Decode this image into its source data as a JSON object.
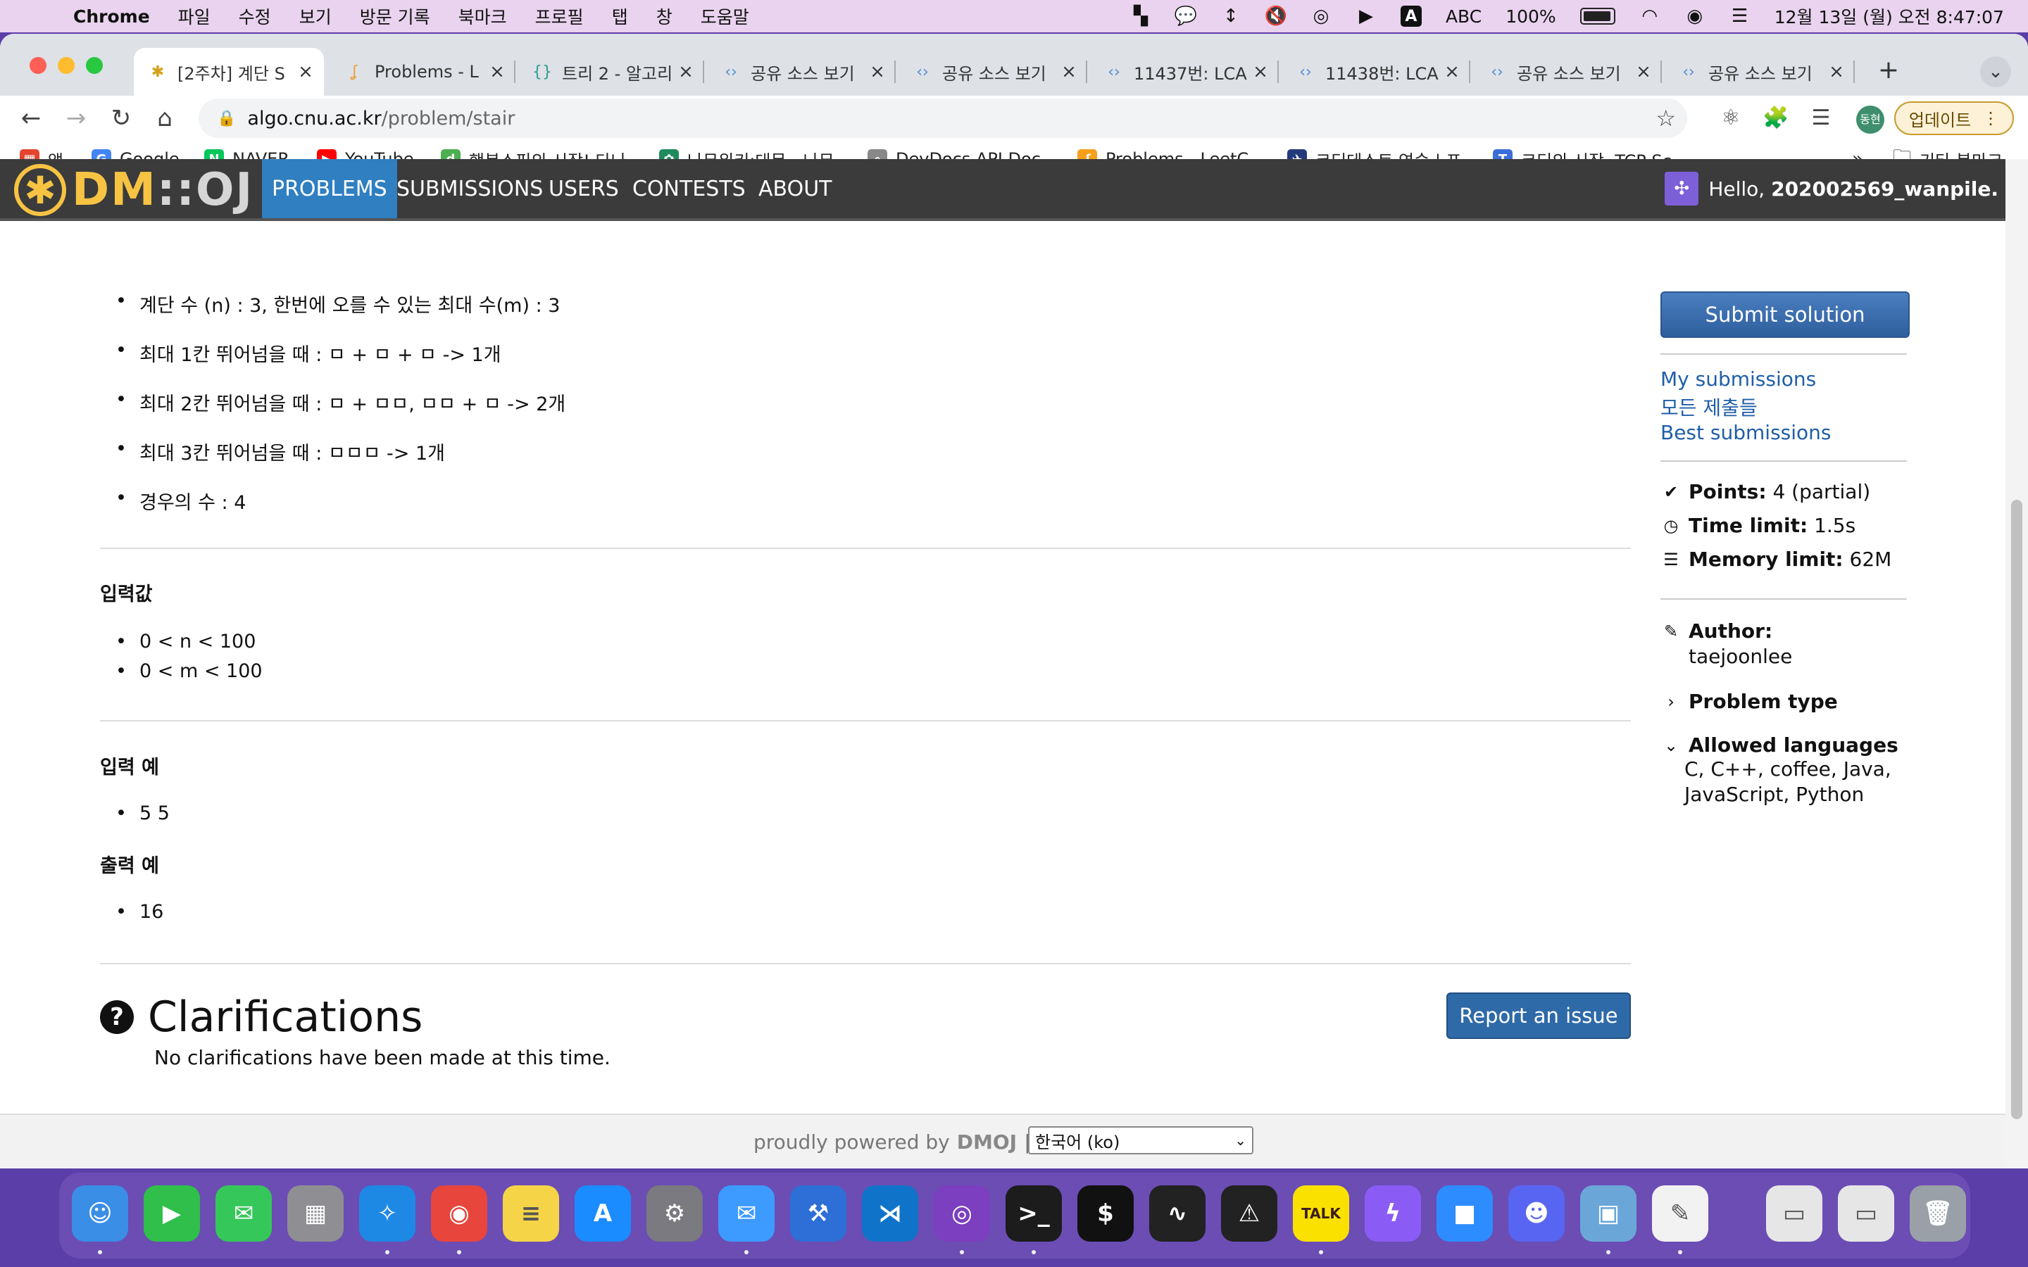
{
  "menubar": {
    "app_name": "Chrome",
    "items": [
      "파일",
      "수정",
      "보기",
      "방문 기록",
      "북마크",
      "프로필",
      "탭",
      "창",
      "도움말"
    ],
    "input_source": "ABC",
    "battery": "100%",
    "clock": "12월 13일 (월) 오전 8:47:07"
  },
  "tabs": [
    {
      "label": "[2주차] 계단 S",
      "icon": "dmoj-star-icon",
      "active": true
    },
    {
      "label": "Problems - L",
      "icon": "leetcode-icon"
    },
    {
      "label": "트리 2 - 알고리",
      "icon": "code-brace-icon"
    },
    {
      "label": "공유 소스 보기",
      "icon": "code-icon"
    },
    {
      "label": "공유 소스 보기",
      "icon": "code-icon"
    },
    {
      "label": "11437번: LCA",
      "icon": "code-icon"
    },
    {
      "label": "11438번: LCA",
      "icon": "code-icon"
    },
    {
      "label": "공유 소스 보기",
      "icon": "code-icon"
    },
    {
      "label": "공유 소스 보기",
      "icon": "code-icon"
    }
  ],
  "address": {
    "host": "algo.cnu.ac.kr",
    "path": "/problem/stair"
  },
  "update_button": "업데이트",
  "profile_initials": "동현",
  "bookmarks": [
    {
      "label": "앱",
      "color": "#e3452f"
    },
    {
      "label": "Google",
      "color": "#4285f4"
    },
    {
      "label": "NAVER",
      "color": "#03c75a"
    },
    {
      "label": "YouTube",
      "color": "#ff0000"
    },
    {
      "label": "행복쇼핑의 시작! 다나...",
      "color": "#4caf50"
    },
    {
      "label": "나무위키:대문 - 나무...",
      "color": "#1f8a5c"
    },
    {
      "label": "DevDocs API Doc...",
      "color": "#888888"
    },
    {
      "label": "Problems - LeetC...",
      "color": "#f89f1b"
    },
    {
      "label": "코딩테스트 연습 | 프...",
      "color": "#233a7d"
    },
    {
      "label": "코딩의 시작, TCP Sc...",
      "color": "#3c6ed9"
    }
  ],
  "bookmarks_more": "»",
  "other_bookmarks": "기타 북마크",
  "site": {
    "logo_dm": "DM",
    "logo_sep": "::",
    "logo_oj": "OJ",
    "nav": [
      "PROBLEMS",
      "SUBMISSIONS",
      "USERS",
      "CONTESTS",
      "ABOUT"
    ],
    "hello_prefix": "Hello, ",
    "username": "202002569_wanpile."
  },
  "problem": {
    "example_bullets": [
      "계단 수 (n) : 3, 한번에 오를 수 있는 최대 수(m) : 3",
      "최대 1칸 뛰어넘을 때 : ㅁ + ㅁ + ㅁ -> 1개",
      "최대 2칸 뛰어넘을 때 : ㅁ + ㅁㅁ, ㅁㅁ + ㅁ -> 2개",
      "최대 3칸 뛰어넘을 때 : ㅁㅁㅁ -> 1개",
      "경우의 수 : 4"
    ],
    "input_heading": "입력값",
    "input_bullets": [
      "0 < n < 100",
      "0 < m < 100"
    ],
    "sample_input_heading": "입력 예",
    "sample_input": "5 5",
    "sample_output_heading": "출력 예",
    "sample_output": "16"
  },
  "clarifications": {
    "title": "Clarifications",
    "text": "No clarifications have been made at this time.",
    "report_button": "Report an issue"
  },
  "sidebar": {
    "submit_button": "Submit solution",
    "links": [
      "My submissions",
      "모든 제출들",
      "Best submissions"
    ],
    "points_label": "Points:",
    "points_value": "4 (partial)",
    "time_label": "Time limit:",
    "time_value": "1.5s",
    "memory_label": "Memory limit:",
    "memory_value": "62M",
    "author_label": "Author:",
    "author_value": "taejoonlee",
    "problem_type_label": "Problem type",
    "languages_label": "Allowed languages",
    "languages_line1": "C, C++, coffee, Java,",
    "languages_line2": "JavaScript, Python"
  },
  "footer": {
    "powered_prefix": "proudly powered by",
    "powered_brand": "DMOJ",
    "separator": "|",
    "language": "한국어 (ko)"
  },
  "dock": [
    {
      "name": "finder-icon",
      "color": "#3a8ee6",
      "glyph": "☺"
    },
    {
      "name": "facetime-icon",
      "color": "#2fbf4a",
      "glyph": "▶"
    },
    {
      "name": "messages-icon",
      "color": "#35c759",
      "glyph": "✉"
    },
    {
      "name": "launchpad-icon",
      "color": "#8e8e93",
      "glyph": "▦"
    },
    {
      "name": "safari-icon",
      "color": "#1e88e5",
      "glyph": "✧"
    },
    {
      "name": "chrome-icon",
      "color": "#e8453c",
      "glyph": "◉"
    },
    {
      "name": "notes-icon",
      "color": "#f5d547",
      "glyph": "≡"
    },
    {
      "name": "app-store-icon",
      "color": "#1a8cff",
      "glyph": "A"
    },
    {
      "name": "system-preferences-icon",
      "color": "#7a7a80",
      "glyph": "⚙"
    },
    {
      "name": "mail-icon",
      "color": "#3d9bff",
      "glyph": "✉"
    },
    {
      "name": "xcode-icon",
      "color": "#2d6fd6",
      "glyph": "⚒"
    },
    {
      "name": "vscode-icon",
      "color": "#0f74c9",
      "glyph": "⋊"
    },
    {
      "name": "github-desktop-icon",
      "color": "#7b3fbf",
      "glyph": "◎"
    },
    {
      "name": "terminal-icon",
      "color": "#1c1c1c",
      "glyph": ">_"
    },
    {
      "name": "iterm-icon",
      "color": "#111111",
      "glyph": "$"
    },
    {
      "name": "activity-monitor-icon",
      "color": "#222222",
      "glyph": "∿"
    },
    {
      "name": "console-icon",
      "color": "#222222",
      "glyph": "⚠"
    },
    {
      "name": "kakaotalk-icon",
      "color": "#fae100",
      "glyph": "TALK"
    },
    {
      "name": "messenger-icon",
      "color": "#8a5cf5",
      "glyph": "ϟ"
    },
    {
      "name": "zoom-icon",
      "color": "#2d8cff",
      "glyph": "■"
    },
    {
      "name": "discord-icon",
      "color": "#5865f2",
      "glyph": "☻"
    },
    {
      "name": "preview-icon",
      "color": "#6aa7d8",
      "glyph": "▣"
    },
    {
      "name": "textedit-icon",
      "color": "#f2f2f2",
      "glyph": "✎"
    },
    {
      "name": "recent-window-icon",
      "color": "#e6e6e6",
      "glyph": "▭"
    },
    {
      "name": "recent-window-icon",
      "color": "#e6e6e6",
      "glyph": "▭"
    },
    {
      "name": "trash-icon",
      "color": "#9aa0a8",
      "glyph": "🗑"
    }
  ]
}
